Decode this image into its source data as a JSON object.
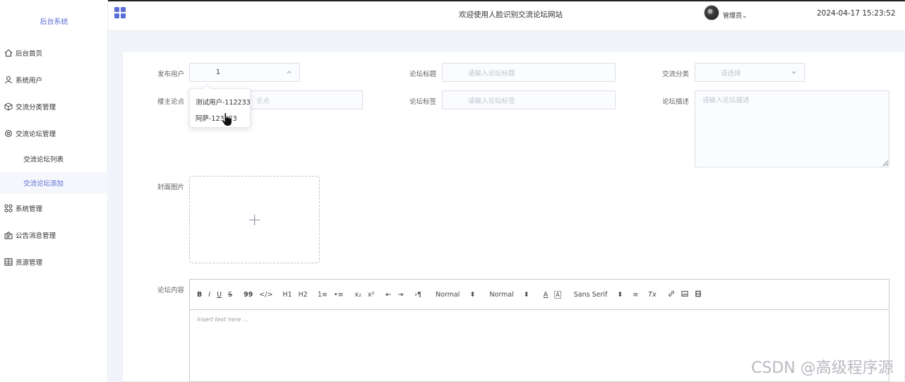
{
  "sidebar": {
    "brand": "后台系统",
    "items": [
      {
        "label": "后台首页",
        "icon": "home-icon"
      },
      {
        "label": "系统用户",
        "icon": "user-icon"
      },
      {
        "label": "交流分类管理",
        "icon": "box-icon"
      },
      {
        "label": "交流论坛管理",
        "icon": "gear-icon"
      },
      {
        "label": "交流论坛列表"
      },
      {
        "label": "交流论坛添加"
      },
      {
        "label": "系统管理",
        "icon": "apps-icon"
      },
      {
        "label": "公告消息管理",
        "icon": "notice-icon"
      },
      {
        "label": "资源管理",
        "icon": "table-icon"
      }
    ]
  },
  "header": {
    "welcome": "欢迎使用人脸识别交流论坛网站",
    "admin": "管理员",
    "datetime": "2024-04-17 15:23:52"
  },
  "form": {
    "user_label": "发布用户",
    "user_value": "1",
    "title_label": "论坛标题",
    "title_placeholder": "请输入论坛标题",
    "category_label": "交流分类",
    "category_placeholder": "请选择",
    "viewpoint_label": "楼主论点",
    "viewpoint_placeholder": "论点",
    "tags_label": "论坛标签",
    "tags_placeholder": "请输入论坛标签",
    "desc_label": "论坛描述",
    "desc_placeholder": "请输入论坛描述",
    "cover_label": "封面图片",
    "cover_plus": "+",
    "content_label": "论坛内容"
  },
  "dropdown": {
    "options": [
      "测试用户-112233",
      "阿萨-123123"
    ]
  },
  "editor": {
    "toolbar": {
      "bold": "B",
      "italic": "I",
      "underline": "U",
      "strike": "S",
      "quote": "99",
      "code": "</>",
      "h1": "H1",
      "h2": "H2",
      "ol": "1≡",
      "ul": "•≡",
      "sub": "x₂",
      "sup": "x²",
      "outdent": "⇤",
      "indent": "⇥",
      "rtl": "›¶",
      "size": "Normal",
      "header": "Normal",
      "color": "A",
      "background": "A",
      "font": "Sans Serif",
      "align": "≡",
      "clean": "Tx",
      "link": "🔗",
      "image": "▣",
      "video": "▤"
    },
    "placeholder": "Insert text here ..."
  },
  "watermark": "CSDN @高级程序源"
}
